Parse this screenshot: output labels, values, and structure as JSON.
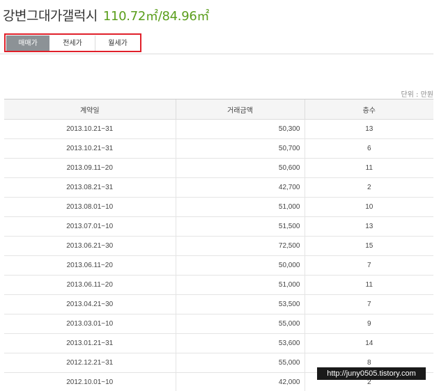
{
  "header": {
    "complex_name": "강변그대가갤럭시",
    "area": "110.72㎡/84.96㎡"
  },
  "tabs": [
    {
      "label": "매매가",
      "active": true
    },
    {
      "label": "전세가",
      "active": false
    },
    {
      "label": "월세가",
      "active": false
    }
  ],
  "unit_note": "단위 : 만원",
  "table": {
    "columns": [
      "계약일",
      "거래금액",
      "층수"
    ],
    "rows": [
      {
        "date": "2013.10.21~31",
        "price": "50,300",
        "floor": "13"
      },
      {
        "date": "2013.10.21~31",
        "price": "50,700",
        "floor": "6"
      },
      {
        "date": "2013.09.11~20",
        "price": "50,600",
        "floor": "11"
      },
      {
        "date": "2013.08.21~31",
        "price": "42,700",
        "floor": "2"
      },
      {
        "date": "2013.08.01~10",
        "price": "51,000",
        "floor": "10"
      },
      {
        "date": "2013.07.01~10",
        "price": "51,500",
        "floor": "13"
      },
      {
        "date": "2013.06.21~30",
        "price": "72,500",
        "floor": "15"
      },
      {
        "date": "2013.06.11~20",
        "price": "50,000",
        "floor": "7"
      },
      {
        "date": "2013.06.11~20",
        "price": "51,000",
        "floor": "11"
      },
      {
        "date": "2013.04.21~30",
        "price": "53,500",
        "floor": "7"
      },
      {
        "date": "2013.03.01~10",
        "price": "55,000",
        "floor": "9"
      },
      {
        "date": "2013.01.21~31",
        "price": "53,600",
        "floor": "14"
      },
      {
        "date": "2012.12.21~31",
        "price": "55,000",
        "floor": "8"
      },
      {
        "date": "2012.10.01~10",
        "price": "42,000",
        "floor": "2"
      }
    ]
  },
  "watermark": "http://juny0505.tistory.com",
  "colors": {
    "title_area": "#5a9e1b",
    "active_tab_bg": "#8c9296",
    "highlight_border": "#e0202a"
  }
}
